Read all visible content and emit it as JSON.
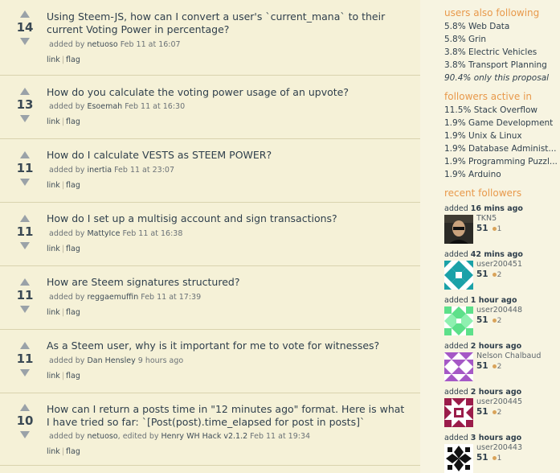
{
  "questions": [
    {
      "votes": "14",
      "title": "Using Steem-JS, how can I convert a user's `current_mana` to their current Voting Power in percentage?",
      "meta_prefix": "added by",
      "user": "netuoso",
      "time": "Feb 11 at 16:07",
      "link": "link",
      "flag": "flag"
    },
    {
      "votes": "13",
      "title": "How do you calculate the voting power usage of an upvote?",
      "meta_prefix": "added by",
      "user": "Esoemah",
      "time": "Feb 11 at 16:30",
      "link": "link",
      "flag": "flag"
    },
    {
      "votes": "11",
      "title": "How do I calculate VESTS as STEEM POWER?",
      "meta_prefix": "added by",
      "user": "inertia",
      "time": "Feb 11 at 23:07",
      "link": "link",
      "flag": "flag"
    },
    {
      "votes": "11",
      "title": "How do I set up a multisig account and sign transactions?",
      "meta_prefix": "added by",
      "user": "MattyIce",
      "time": "Feb 11 at 16:38",
      "link": "link",
      "flag": "flag"
    },
    {
      "votes": "11",
      "title": "How are Steem signatures structured?",
      "meta_prefix": "added by",
      "user": "reggaemuffin",
      "time": "Feb 11 at 17:39",
      "link": "link",
      "flag": "flag"
    },
    {
      "votes": "11",
      "title": "As a Steem user, why is it important for me to vote for witnesses?",
      "meta_prefix": "added by",
      "user": "Dan Hensley",
      "time": "9 hours ago",
      "link": "link",
      "flag": "flag"
    },
    {
      "votes": "10",
      "title": "How can I return a posts time in \"12 minutes ago\" format. Here is what I have tried so far: `[Post(post).time_elapsed for post in posts]`",
      "meta_prefix": "added by",
      "user": "netuoso",
      "meta_mid": ", edited by",
      "user2": "Henry WH Hack v2.1.2",
      "time": "Feb 11 at 19:34",
      "link": "link",
      "flag": "flag"
    }
  ],
  "sidebar": {
    "also_following": {
      "heading": "users also following",
      "items": [
        "5.8% Web Data",
        "5.8% Grin",
        "3.8% Electric Vehicles",
        "3.8% Transport Planning"
      ],
      "note": "90.4% only this proposal"
    },
    "active_in": {
      "heading": "followers active in",
      "items": [
        "11.5% Stack Overflow",
        "1.9% Game Development",
        "1.9% Unix & Linux",
        "1.9% Database Administ...",
        "1.9% Programming Puzzl...",
        "1.9% Arduino"
      ]
    },
    "recent": {
      "heading": "recent followers",
      "added_label": "added",
      "followers": [
        {
          "when": "16 mins ago",
          "name": "TKN5",
          "rep": "51",
          "badge": "1"
        },
        {
          "when": "42 mins ago",
          "name": "user200451",
          "rep": "51",
          "badge": "2"
        },
        {
          "when": "1 hour ago",
          "name": "user200448",
          "rep": "51",
          "badge": "2"
        },
        {
          "when": "2 hours ago",
          "name": "Nelson Chalbaud",
          "rep": "51",
          "badge": "2"
        },
        {
          "when": "2 hours ago",
          "name": "user200445",
          "rep": "51",
          "badge": "2"
        },
        {
          "when": "3 hours ago",
          "name": "user200443",
          "rep": "51",
          "badge": "1"
        }
      ]
    }
  },
  "colors": {
    "accent_heading": "#e8994b",
    "page_bg": "#f7f4e1",
    "badge_bronze": "#d9a35a"
  }
}
